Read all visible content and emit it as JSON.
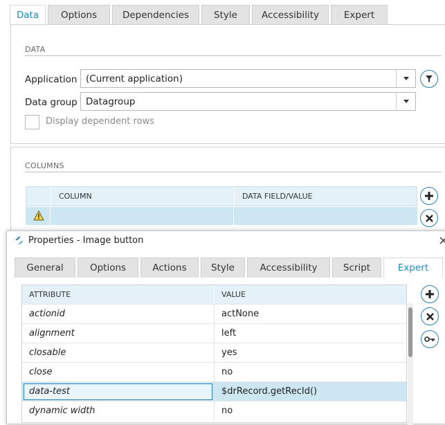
{
  "top_tabs": [
    {
      "label": "Data",
      "active": true
    },
    {
      "label": "Options",
      "active": false
    },
    {
      "label": "Dependencies",
      "active": false
    },
    {
      "label": "Style",
      "active": false
    },
    {
      "label": "Accessibility",
      "active": false
    },
    {
      "label": "Expert",
      "active": false
    }
  ],
  "data_section": {
    "title": "DATA",
    "application_label": "Application",
    "application_value": "(Current application)",
    "datagroup_label": "Data group",
    "datagroup_value": "Datagroup",
    "dependent_rows_label": "Display dependent rows",
    "filter_icon": "filter-icon"
  },
  "columns_section": {
    "title": "COLUMNS",
    "headers": [
      "COLUMN",
      "DATA FIELD/VALUE"
    ],
    "warning_icon": "warning-icon"
  },
  "dialog": {
    "title": "Properties - Image button",
    "tabs": [
      {
        "label": "General",
        "active": false
      },
      {
        "label": "Options",
        "active": false
      },
      {
        "label": "Actions",
        "active": false
      },
      {
        "label": "Style",
        "active": false
      },
      {
        "label": "Accessibility",
        "active": false
      },
      {
        "label": "Script",
        "active": false
      },
      {
        "label": "Expert",
        "active": true
      }
    ],
    "table_headers": [
      "ATTRIBUTE",
      "VALUE"
    ],
    "rows": [
      {
        "attribute": "actionid",
        "value": "actNone"
      },
      {
        "attribute": "alignment",
        "value": "left"
      },
      {
        "attribute": "closable",
        "value": "yes"
      },
      {
        "attribute": "close",
        "value": "no"
      },
      {
        "attribute": "data-test",
        "value": "$drRecord.getRecId()"
      },
      {
        "attribute": "dynamic width",
        "value": "no"
      }
    ]
  },
  "colors": {
    "accent": "#1a8bc4",
    "selected_row": "#cce7f2",
    "header_bg": "#e4f1f8"
  }
}
